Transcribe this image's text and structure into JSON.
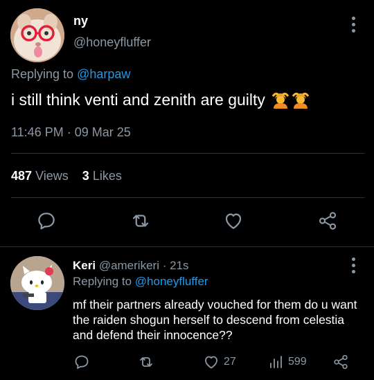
{
  "main_tweet": {
    "display_name": "ny",
    "handle": "@honeyfluffer",
    "replying_prefix": "Replying to ",
    "replying_to": "@harpaw",
    "text": "i still think venti and zenith are guilty",
    "emojis": [
      "person-gesturing-ok-emoji",
      "person-gesturing-ok-emoji"
    ],
    "timestamp": "11:46 PM · 09 Mar 25",
    "views_count": "487",
    "views_label": "Views",
    "likes_count": "3",
    "likes_label": "Likes",
    "actions": [
      "reply-icon",
      "retweet-icon",
      "heart-icon",
      "share-icon"
    ]
  },
  "reply_tweet": {
    "display_name": "Keri",
    "handle_meta": "@amerikeri · 21s",
    "replying_prefix": "Replying to ",
    "replying_to": "@honeyfluffer",
    "text": "mf their partners already vouched for them do u want the raiden shogun herself to descend from celestia and defend their innocence??",
    "likes": "27",
    "views": "599"
  },
  "colors": {
    "background": "#000000",
    "text": "#ffffff",
    "muted": "#8b98a5",
    "link": "#1d9bf0",
    "divider": "#2f3336"
  }
}
